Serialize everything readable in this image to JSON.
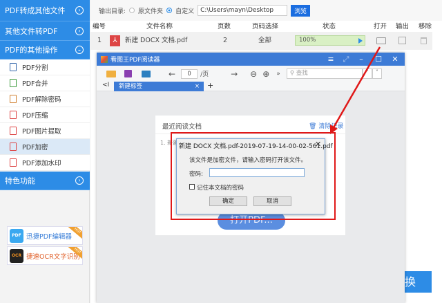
{
  "sidebar": {
    "sections": [
      {
        "label": "PDF转成其他文件",
        "icon": "chevron-right-circle-icon"
      },
      {
        "label": "其他文件转PDF",
        "icon": "chevron-right-circle-icon"
      },
      {
        "label": "PDF的其他操作",
        "icon": "chevron-down-circle-icon"
      },
      {
        "label": "特色功能",
        "icon": "chevron-right-circle-icon"
      }
    ],
    "items": [
      "PDF分割",
      "PDF合并",
      "PDF解除密码",
      "PDF压缩",
      "PDF图片提取",
      "PDF加密",
      "PDF添加水印"
    ],
    "active_item": "PDF加密",
    "promos": [
      {
        "label": "迅捷PDF编辑器",
        "logo": "PDF",
        "badge": "HOT"
      },
      {
        "label": "捷速OCR文字识别",
        "logo": "OCR",
        "badge": "HOT"
      }
    ]
  },
  "toolbar": {
    "output_label": "输出目录:",
    "option_source": "原文件夹",
    "option_custom": "自定义",
    "path": "C:\\Users\\mayn\\Desktop",
    "browse": "浏览"
  },
  "table": {
    "headers": [
      "编号",
      "文件名称",
      "页数",
      "页码选择",
      "状态",
      "打开",
      "输出",
      "移除"
    ],
    "rows": [
      {
        "num": "1",
        "name": "新建 DOCX 文档.pdf",
        "pages": "2",
        "range": "全部",
        "status": "100%",
        "progress": 100
      }
    ]
  },
  "reader": {
    "title": "看图王PDF阅读器",
    "page_input": "0",
    "page_suffix": "/页",
    "search_placeholder": "查找",
    "tab": "新建标签",
    "tab_close": "×",
    "tab_add": "+",
    "tab_back": "<I",
    "recent_title": "最近阅读文档",
    "clear_label": "清除记录",
    "recent_item": "1. 新建",
    "open_button": "打开PDF..."
  },
  "dialog": {
    "title": "新建 DOCX 文档.pdf-2019-07-19-14-00-02-561.pdf",
    "message": "该文件是加密文件，请输入密码打开该文件。",
    "password_label": "密码:",
    "password_value": "",
    "remember": "记住本文档的密码",
    "ok": "确定",
    "cancel": "取消"
  },
  "convert_button": "换",
  "colors": {
    "accent": "#2d8ce6",
    "reader_title": "#3d7bd6",
    "highlight": "#e01818"
  }
}
